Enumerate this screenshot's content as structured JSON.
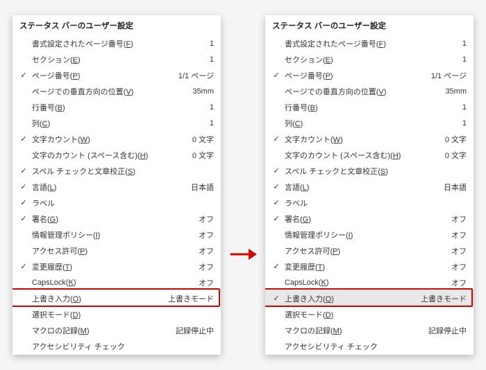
{
  "title": "ステータス バーのユーザー設定",
  "items": [
    {
      "label": "書式設定されたページ番号",
      "mnemonic": "F",
      "value": "1",
      "checked": false
    },
    {
      "label": "セクション",
      "mnemonic": "E",
      "value": "1",
      "checked": false
    },
    {
      "label": "ページ番号",
      "mnemonic": "P",
      "value": "1/1 ページ",
      "checked": true
    },
    {
      "label": "ページでの垂直方向の位置",
      "mnemonic": "V",
      "value": "35mm",
      "checked": false
    },
    {
      "label": "行番号",
      "mnemonic": "B",
      "value": "1",
      "checked": false
    },
    {
      "label": "列",
      "mnemonic": "C",
      "value": "1",
      "checked": false
    },
    {
      "label": "文字カウント",
      "mnemonic": "W",
      "value": "0 文字",
      "checked": true
    },
    {
      "label": "文字のカウント (スペース含む)",
      "mnemonic": "H",
      "value": "0 文字",
      "checked": false
    },
    {
      "label": "スペル チェックと文章校正",
      "mnemonic": "S",
      "value": "",
      "checked": true
    },
    {
      "label": "言語",
      "mnemonic": "L",
      "value": "日本語",
      "checked": true
    },
    {
      "label": "ラベル",
      "mnemonic": "",
      "value": "",
      "checked": true
    },
    {
      "label": "署名",
      "mnemonic": "G",
      "value": "オフ",
      "checked": true
    },
    {
      "label": "情報管理ポリシー",
      "mnemonic": "I",
      "value": "オフ",
      "checked": false
    },
    {
      "label": "アクセス許可",
      "mnemonic": "P",
      "value": "オフ",
      "checked": false
    },
    {
      "label": "変更履歴",
      "mnemonic": "T",
      "value": "オフ",
      "checked": true
    },
    {
      "label": "CapsLock",
      "mnemonic": "K",
      "value": "オフ",
      "checked": false
    },
    {
      "label": "上書き入力",
      "mnemonic": "O",
      "value": "上書きモード",
      "checked": false
    },
    {
      "label": "選択モード",
      "mnemonic": "D",
      "value": "",
      "checked": false
    },
    {
      "label": "マクロの記録",
      "mnemonic": "M",
      "value": "記録停止中",
      "checked": false
    },
    {
      "label": "アクセシビリティ チェック",
      "mnemonic": "",
      "value": "",
      "checked": false
    }
  ],
  "highlight_index": 16,
  "right_checked_index": 16,
  "right_selected_index": 16,
  "arrow_color": "#d60000"
}
